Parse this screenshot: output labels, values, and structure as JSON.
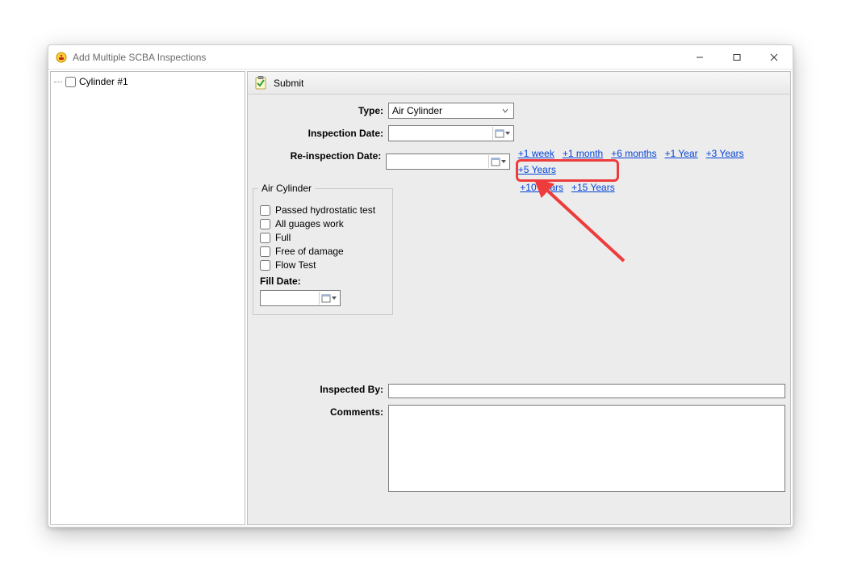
{
  "window": {
    "title": "Add Multiple SCBA Inspections"
  },
  "tree": {
    "items": [
      {
        "label": "Cylinder #1"
      }
    ]
  },
  "toolbar": {
    "submit_label": "Submit"
  },
  "form": {
    "type_label": "Type:",
    "type_value": "Air Cylinder",
    "inspection_date_label": "Inspection Date:",
    "inspection_date_value": "",
    "reinspection_date_label": "Re-inspection Date:",
    "reinspection_date_value": "",
    "quick": {
      "w1": "+1 week",
      "m1": "+1 month",
      "m6": "+6 months",
      "y1": "+1 Year",
      "y3": "+3 Years",
      "y5": "+5 Years",
      "y10": "+10 Years",
      "y15": "+15 Years"
    },
    "group": {
      "legend": "Air Cylinder",
      "c1": "Passed hydrostatic test",
      "c2": "All guages work",
      "c3": "Full",
      "c4": "Free of damage",
      "c5": "Flow Test",
      "fill_label": "Fill Date:",
      "fill_value": ""
    },
    "inspected_by_label": "Inspected By:",
    "inspected_by_value": "",
    "comments_label": "Comments:",
    "comments_value": ""
  }
}
